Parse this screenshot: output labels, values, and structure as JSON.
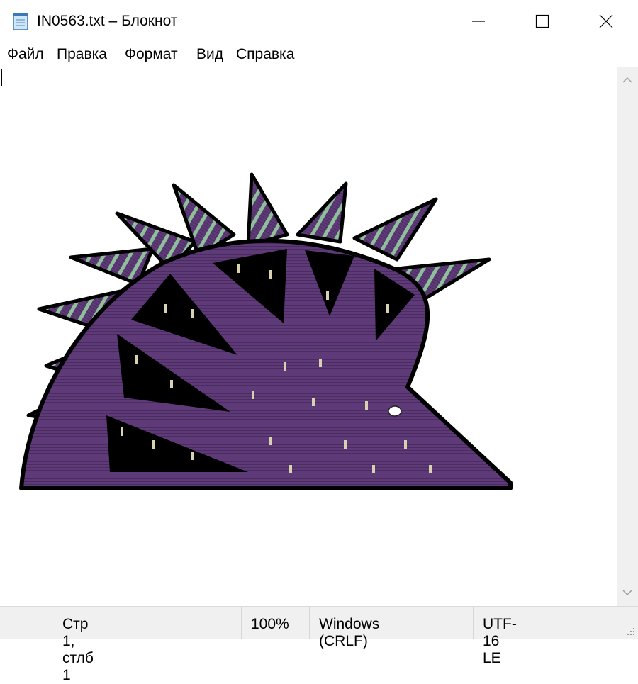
{
  "window": {
    "title": "IN0563.txt – Блокнот",
    "icon": "notepad-icon",
    "controls": [
      "minimize-icon",
      "maximize-icon",
      "close-icon"
    ]
  },
  "menu": {
    "items": [
      "Файл",
      "Правка",
      "Формат",
      "Вид",
      "Справка"
    ]
  },
  "editor": {
    "content_description": "ASCII-art style picture of a purple hedgehog"
  },
  "statusbar": {
    "position": "Стр 1, стлб 1",
    "zoom": "100%",
    "line_ending": "Windows (CRLF)",
    "encoding": "UTF-16 LE"
  },
  "colors": {
    "hedgehog_body": "#5e3a78",
    "hedgehog_stripe": "#8fbf9a",
    "outline": "#000000",
    "chrome": "#f0f0f0"
  }
}
